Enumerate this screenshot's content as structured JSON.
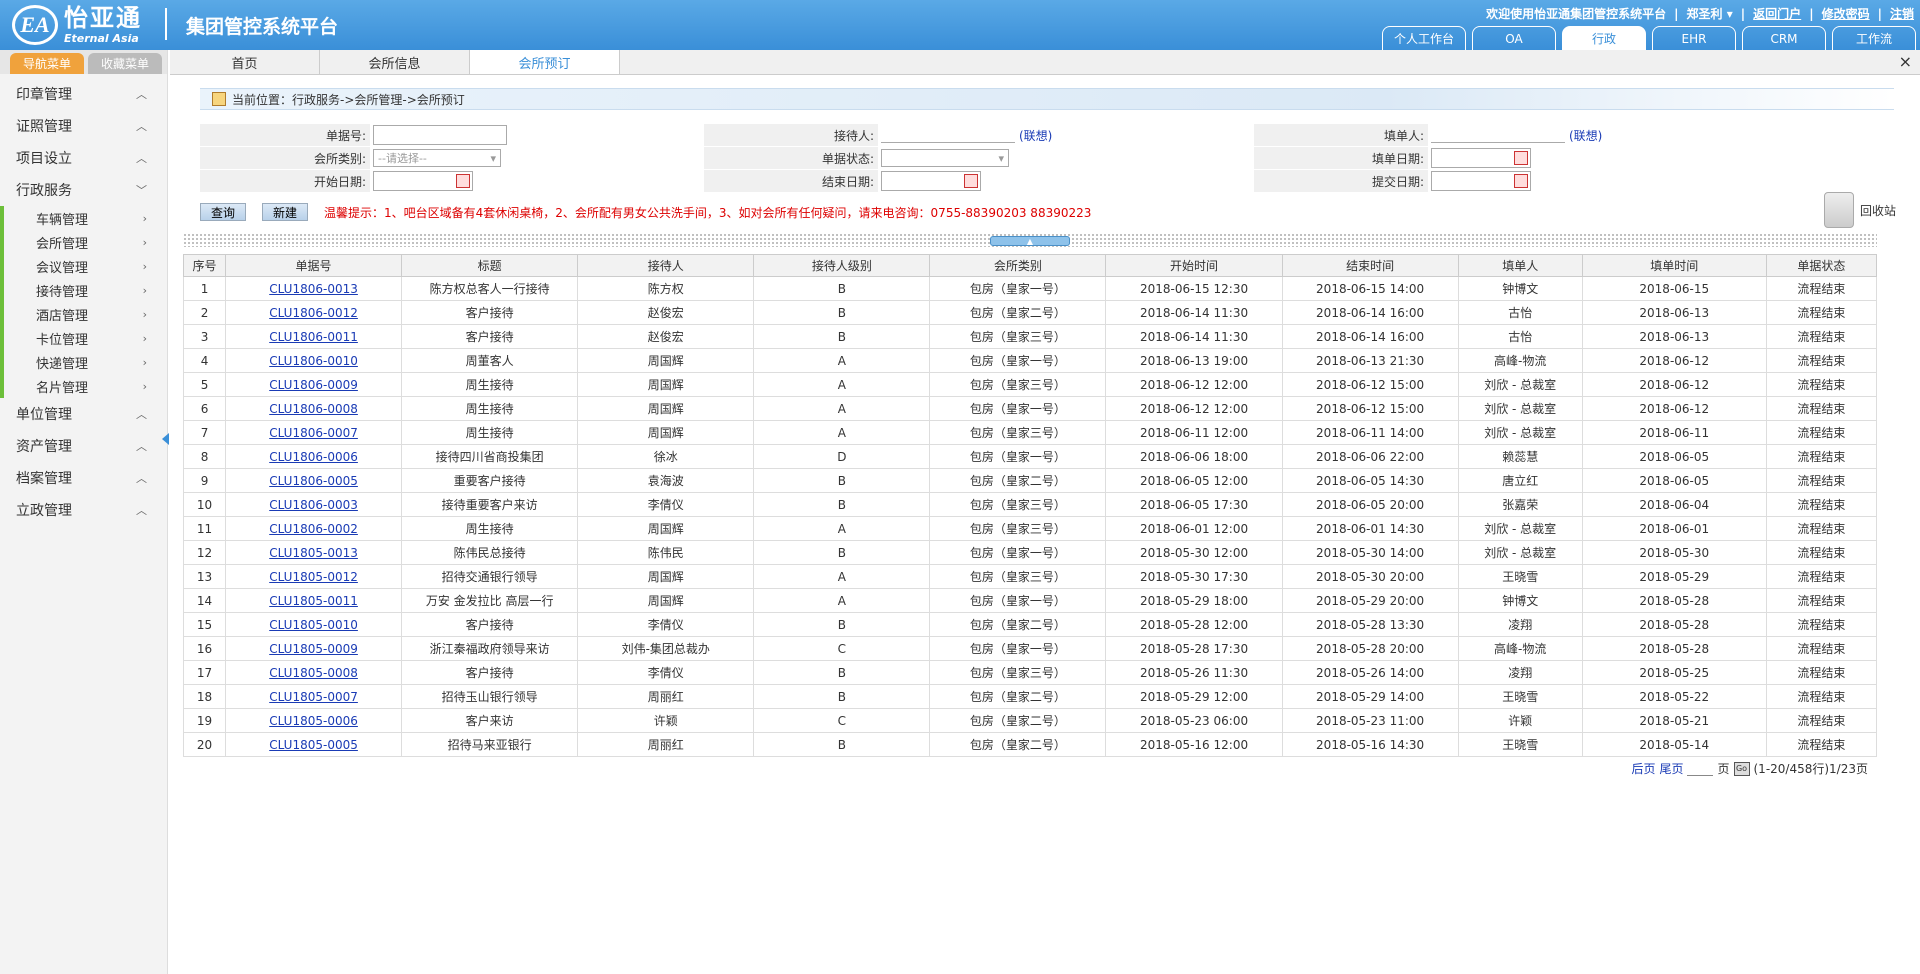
{
  "brand": {
    "logo_mark": "EA",
    "logo_cn": "怡亚通",
    "logo_en": "Eternal Asia",
    "system_title": "集团管控系统平台"
  },
  "top": {
    "welcome": "欢迎使用怡亚通集团管控系统平台",
    "user": "郑圣利",
    "portal": "返回门户",
    "change_pwd": "修改密码",
    "logout": "注销"
  },
  "top_tabs": [
    "个人工作台",
    "OA",
    "行政",
    "EHR",
    "CRM",
    "工作流"
  ],
  "left_tabs": {
    "nav": "导航菜单",
    "fav": "收藏菜单"
  },
  "menu": {
    "top": [
      "印章管理",
      "证照管理",
      "项目设立"
    ],
    "open": "行政服务",
    "sub": [
      "车辆管理",
      "会所管理",
      "会议管理",
      "接待管理",
      "酒店管理",
      "卡位管理",
      "快递管理",
      "名片管理"
    ],
    "bottom": [
      "单位管理",
      "资产管理",
      "档案管理",
      "立政管理"
    ]
  },
  "page_tabs": [
    "首页",
    "会所信息",
    "会所预订"
  ],
  "close_icon": "×",
  "breadcrumb": "当前位置：行政服务->会所管理->会所预订",
  "form": {
    "doc_no": "单据号:",
    "club_type": "会所类别:",
    "start_date": "开始日期:",
    "receiver": "接待人:",
    "doc_status": "单据状态:",
    "end_date": "结束日期:",
    "filler": "填单人:",
    "fill_date": "填单日期:",
    "submit_date": "提交日期:",
    "assoc": "(联想)",
    "select_placeholder": "--请选择--"
  },
  "buttons": {
    "query": "查询",
    "new": "新建"
  },
  "tip": "温馨提示：1、吧台区域备有4套休闲桌椅，2、会所配有男女公共洗手间，3、如对会所有任何疑问，请来电咨询：0755-88390203 88390223",
  "recycle": "回收站",
  "table": {
    "headers": [
      "序号",
      "单据号",
      "标题",
      "接待人",
      "接待人级别",
      "会所类别",
      "开始时间",
      "结束时间",
      "填单人",
      "填单时间",
      "单据状态"
    ],
    "rows": [
      [
        "1",
        "CLU1806-0013",
        "陈方权总客人一行接待",
        "陈方权",
        "B",
        "包房（皇家一号）",
        "2018-06-15 12:30",
        "2018-06-15 14:00",
        "钟博文",
        "2018-06-15",
        "流程结束"
      ],
      [
        "2",
        "CLU1806-0012",
        "客户接待",
        "赵俊宏",
        "B",
        "包房（皇家二号）",
        "2018-06-14 11:30",
        "2018-06-14 16:00",
        "古怡",
        "2018-06-13",
        "流程结束"
      ],
      [
        "3",
        "CLU1806-0011",
        "客户接待",
        "赵俊宏",
        "B",
        "包房（皇家三号）",
        "2018-06-14 11:30",
        "2018-06-14 16:00",
        "古怡",
        "2018-06-13",
        "流程结束"
      ],
      [
        "4",
        "CLU1806-0010",
        "周董客人",
        "周国辉",
        "A",
        "包房（皇家一号）",
        "2018-06-13 19:00",
        "2018-06-13 21:30",
        "高峰-物流",
        "2018-06-12",
        "流程结束"
      ],
      [
        "5",
        "CLU1806-0009",
        "周生接待",
        "周国辉",
        "A",
        "包房（皇家三号）",
        "2018-06-12 12:00",
        "2018-06-12 15:00",
        "刘欣 - 总裁室",
        "2018-06-12",
        "流程结束"
      ],
      [
        "6",
        "CLU1806-0008",
        "周生接待",
        "周国辉",
        "A",
        "包房（皇家一号）",
        "2018-06-12 12:00",
        "2018-06-12 15:00",
        "刘欣 - 总裁室",
        "2018-06-12",
        "流程结束"
      ],
      [
        "7",
        "CLU1806-0007",
        "周生接待",
        "周国辉",
        "A",
        "包房（皇家三号）",
        "2018-06-11 12:00",
        "2018-06-11 14:00",
        "刘欣 - 总裁室",
        "2018-06-11",
        "流程结束"
      ],
      [
        "8",
        "CLU1806-0006",
        "接待四川省商投集团",
        "徐冰",
        "D",
        "包房（皇家一号）",
        "2018-06-06 18:00",
        "2018-06-06 22:00",
        "赖蕊慧",
        "2018-06-05",
        "流程结束"
      ],
      [
        "9",
        "CLU1806-0005",
        "重要客户接待",
        "袁海波",
        "B",
        "包房（皇家二号）",
        "2018-06-05 12:00",
        "2018-06-05 14:30",
        "唐立红",
        "2018-06-05",
        "流程结束"
      ],
      [
        "10",
        "CLU1806-0003",
        "接待重要客户来访",
        "李倩仪",
        "B",
        "包房（皇家三号）",
        "2018-06-05 17:30",
        "2018-06-05 20:00",
        "张嘉荣",
        "2018-06-04",
        "流程结束"
      ],
      [
        "11",
        "CLU1806-0002",
        "周生接待",
        "周国辉",
        "A",
        "包房（皇家三号）",
        "2018-06-01 12:00",
        "2018-06-01 14:30",
        "刘欣 - 总裁室",
        "2018-06-01",
        "流程结束"
      ],
      [
        "12",
        "CLU1805-0013",
        "陈伟民总接待",
        "陈伟民",
        "B",
        "包房（皇家一号）",
        "2018-05-30 12:00",
        "2018-05-30 14:00",
        "刘欣 - 总裁室",
        "2018-05-30",
        "流程结束"
      ],
      [
        "13",
        "CLU1805-0012",
        "招待交通银行领导",
        "周国辉",
        "A",
        "包房（皇家三号）",
        "2018-05-30 17:30",
        "2018-05-30 20:00",
        "王晓雪",
        "2018-05-29",
        "流程结束"
      ],
      [
        "14",
        "CLU1805-0011",
        "万安 金发拉比 高层一行",
        "周国辉",
        "A",
        "包房（皇家一号）",
        "2018-05-29 18:00",
        "2018-05-29 20:00",
        "钟博文",
        "2018-05-28",
        "流程结束"
      ],
      [
        "15",
        "CLU1805-0010",
        "客户接待",
        "李倩仪",
        "B",
        "包房（皇家二号）",
        "2018-05-28 12:00",
        "2018-05-28 13:30",
        "凌翔",
        "2018-05-28",
        "流程结束"
      ],
      [
        "16",
        "CLU1805-0009",
        "浙江秦福政府领导来访",
        "刘伟-集团总裁办",
        "C",
        "包房（皇家一号）",
        "2018-05-28 17:30",
        "2018-05-28 20:00",
        "高峰-物流",
        "2018-05-28",
        "流程结束"
      ],
      [
        "17",
        "CLU1805-0008",
        "客户接待",
        "李倩仪",
        "B",
        "包房（皇家三号）",
        "2018-05-26 11:30",
        "2018-05-26 14:00",
        "凌翔",
        "2018-05-25",
        "流程结束"
      ],
      [
        "18",
        "CLU1805-0007",
        "招待玉山银行领导",
        "周丽红",
        "B",
        "包房（皇家二号）",
        "2018-05-29 12:00",
        "2018-05-29 14:00",
        "王晓雪",
        "2018-05-22",
        "流程结束"
      ],
      [
        "19",
        "CLU1805-0006",
        "客户来访",
        "许颖",
        "C",
        "包房（皇家二号）",
        "2018-05-23 06:00",
        "2018-05-23 11:00",
        "许颖",
        "2018-05-21",
        "流程结束"
      ],
      [
        "20",
        "CLU1805-0005",
        "招待马来亚银行",
        "周丽红",
        "B",
        "包房（皇家二号）",
        "2018-05-16 12:00",
        "2018-05-16 14:30",
        "王晓雪",
        "2018-05-14",
        "流程结束"
      ]
    ]
  },
  "pager": {
    "next": "后页",
    "last": "尾页",
    "page_unit": "页",
    "go": "Go",
    "info": "(1-20/458行)1/23页"
  }
}
